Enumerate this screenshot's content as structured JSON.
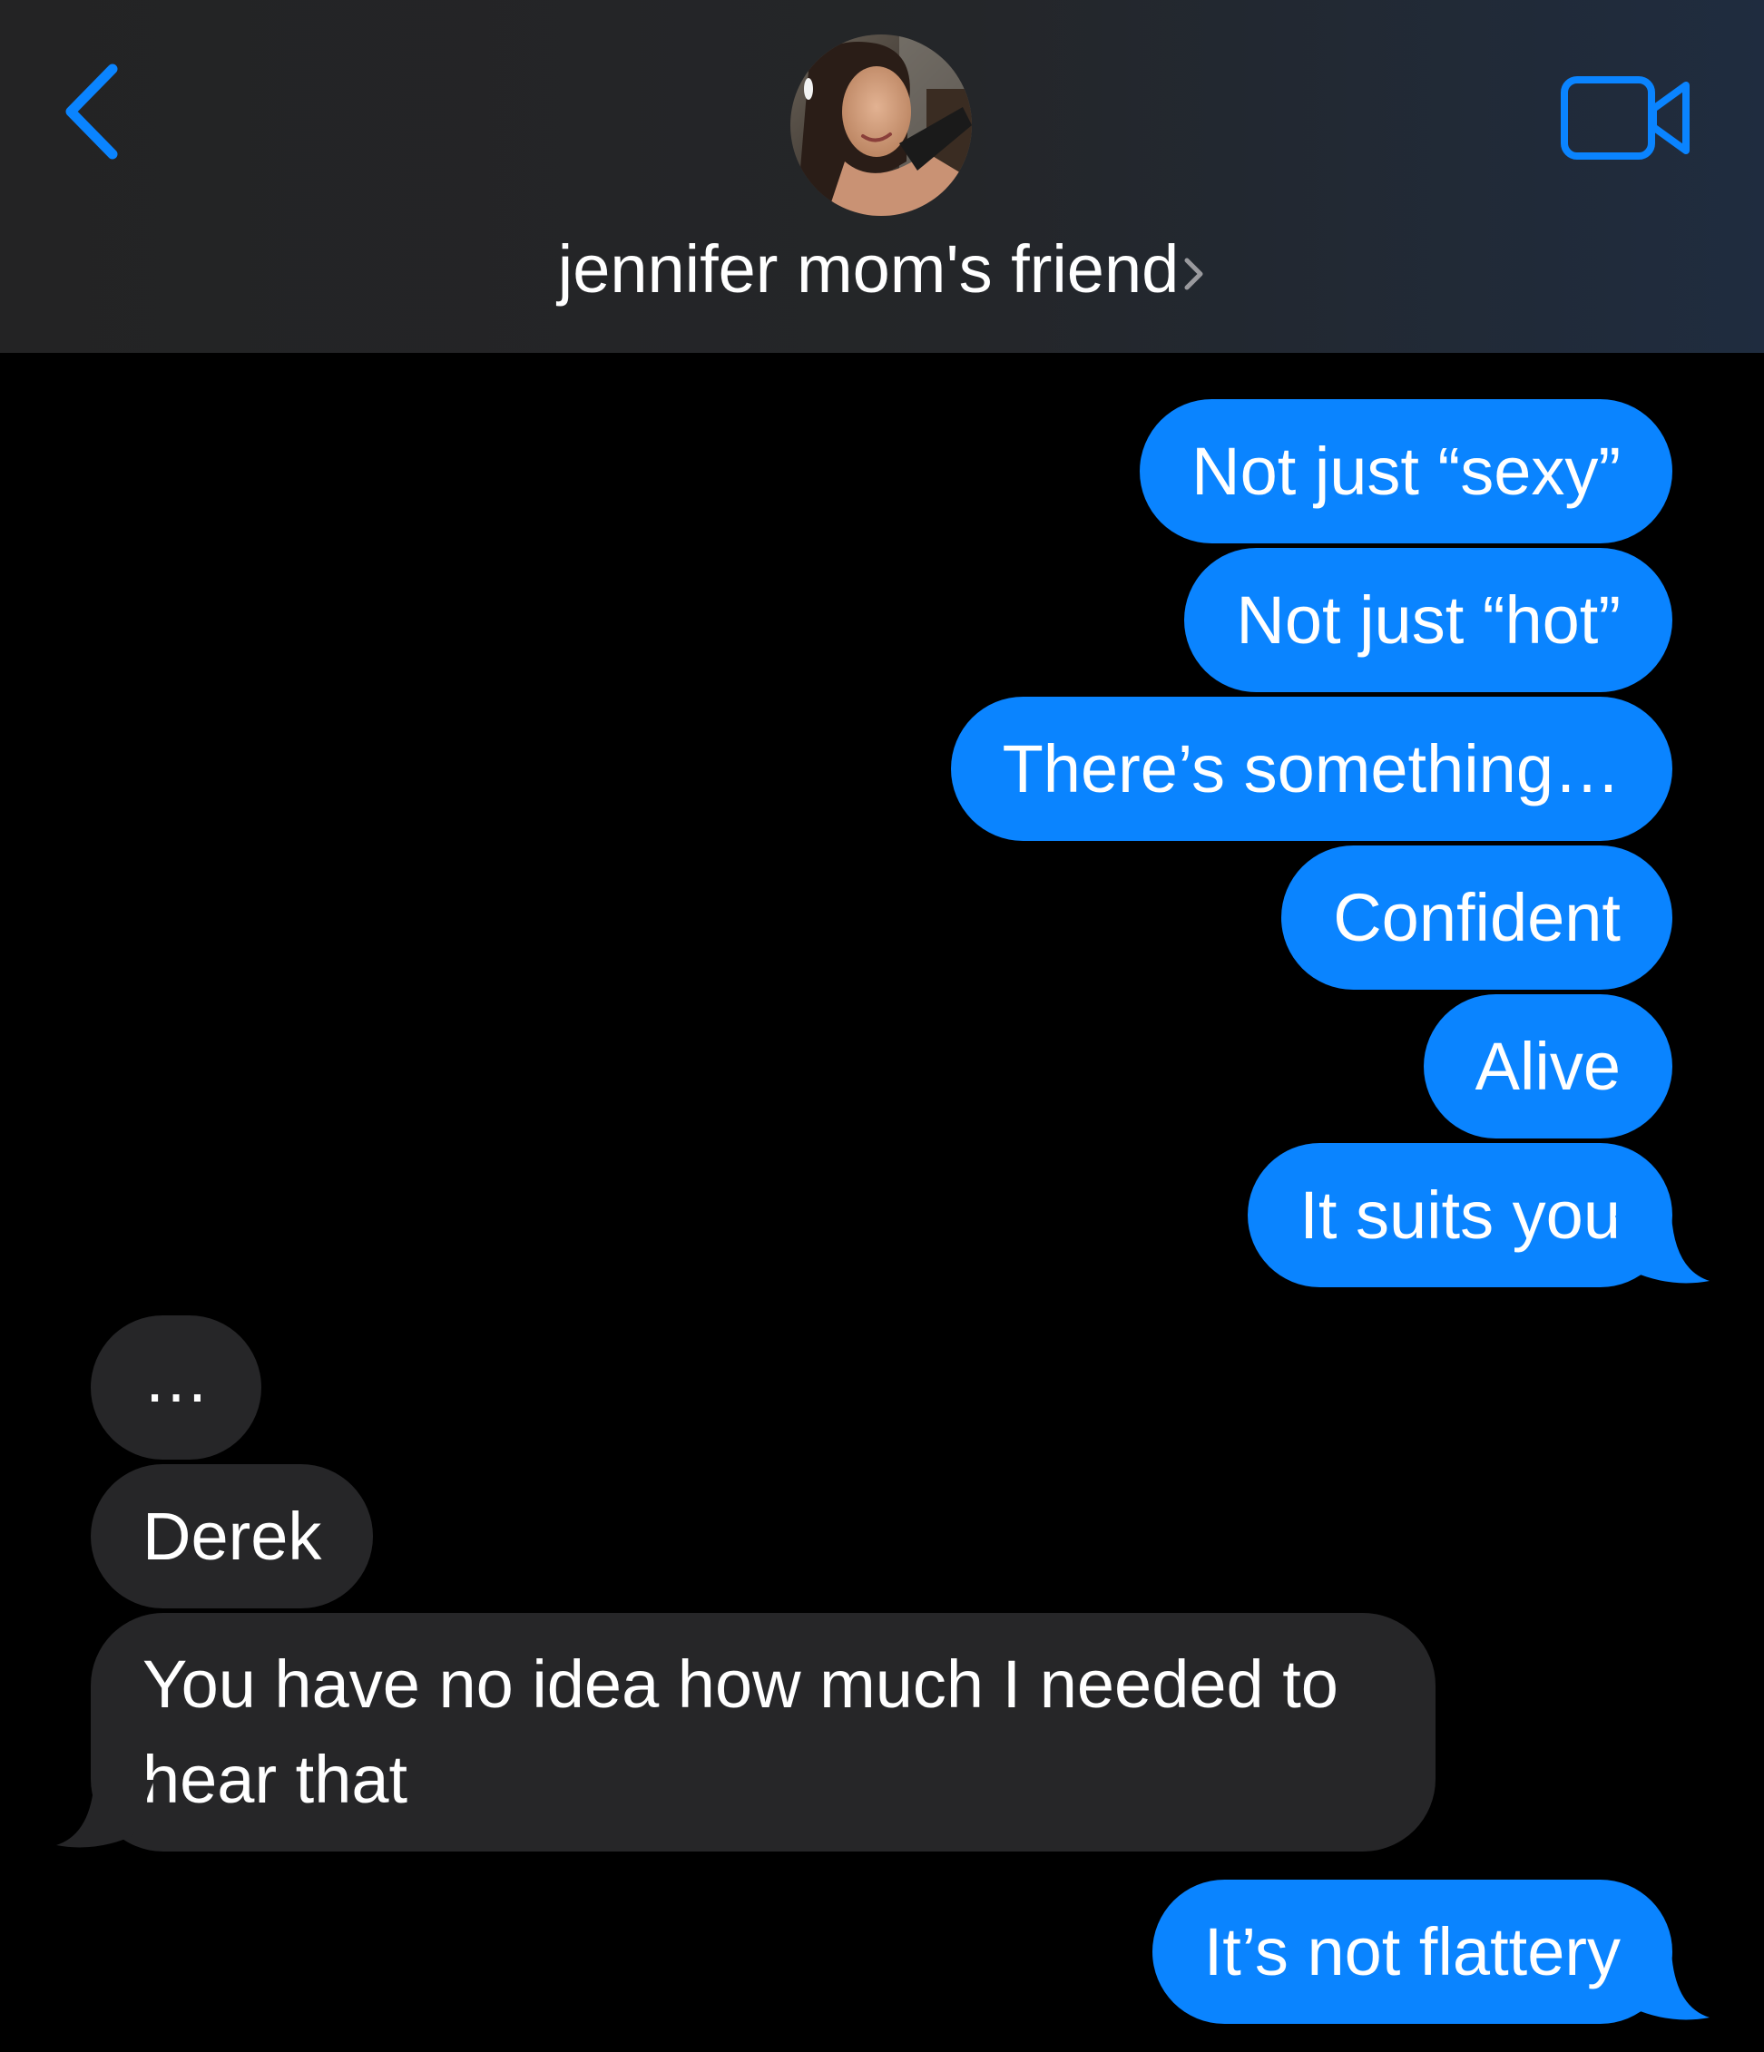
{
  "header": {
    "contact_name": "jennifer mom's friend",
    "back_icon": "chevron-left-icon",
    "video_icon": "video-camera-icon",
    "accent_color": "#0a84ff"
  },
  "messages": [
    {
      "direction": "outgoing",
      "text": "Not just “sexy”"
    },
    {
      "direction": "outgoing",
      "text": "Not just “hot”"
    },
    {
      "direction": "outgoing",
      "text": "There’s something…"
    },
    {
      "direction": "outgoing",
      "text": "Confident"
    },
    {
      "direction": "outgoing",
      "text": "Alive"
    },
    {
      "direction": "outgoing",
      "text": "It suits you"
    },
    {
      "direction": "incoming",
      "text": "…"
    },
    {
      "direction": "incoming",
      "text": "Derek"
    },
    {
      "direction": "incoming",
      "text": "You have no idea how much I needed to hear that"
    },
    {
      "direction": "outgoing",
      "text": "It’s not flattery"
    }
  ],
  "colors": {
    "outgoing_bubble": "#0a84ff",
    "incoming_bubble": "#262628",
    "background": "#000000"
  }
}
